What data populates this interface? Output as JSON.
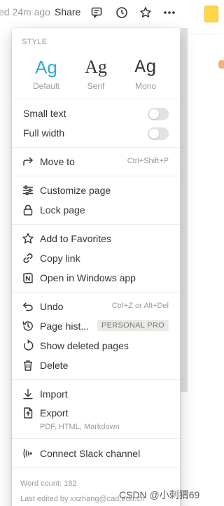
{
  "topbar": {
    "edited": "ed 24m ago",
    "share": "Share",
    "icons": [
      "comment-icon",
      "clock-icon",
      "star-icon",
      "more-icon"
    ]
  },
  "menu": {
    "style_label": "STYLE",
    "styles": [
      {
        "sample": "Ag",
        "caption": "Default",
        "selected": true,
        "color": "#2eaadc"
      },
      {
        "sample": "Ag",
        "caption": "Serif",
        "selected": false
      },
      {
        "sample": "Ag",
        "caption": "Mono",
        "selected": false
      }
    ],
    "small_text": {
      "label": "Small text",
      "on": false
    },
    "full_width": {
      "label": "Full width",
      "on": false
    },
    "move_to": {
      "label": "Move to",
      "shortcut": "Ctrl+Shift+P"
    },
    "customize_page": "Customize page",
    "lock_page": "Lock page",
    "add_favorites": "Add to Favorites",
    "copy_link": "Copy link",
    "open_windows": "Open in Windows app",
    "undo": {
      "label": "Undo",
      "shortcut": "Ctrl+Z or Alt+Del"
    },
    "page_history": {
      "label": "Page hist...",
      "badge": "PERSONAL PRO"
    },
    "show_deleted": "Show deleted pages",
    "delete": "Delete",
    "import": "Import",
    "export": {
      "label": "Export",
      "sub": "PDF, HTML, Markdown"
    },
    "connect_slack": "Connect Slack channel",
    "word_count": "Word count: 182",
    "last_edited": "Last edited by xxzhang@cad.edu.cn"
  },
  "watermark": "CSDN @小刺猬69"
}
